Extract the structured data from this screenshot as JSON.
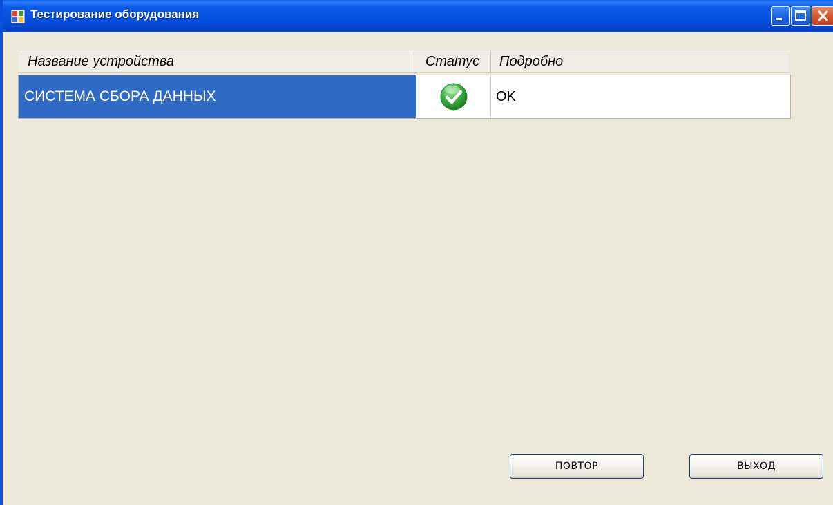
{
  "window": {
    "title": "Тестирование оборудования",
    "icon": "application-icon",
    "controls": [
      "minimize-icon",
      "maximize-icon",
      "close-icon"
    ]
  },
  "grid": {
    "columns": [
      "Название устройства",
      "Статус",
      "Подробно"
    ],
    "rows": [
      {
        "name": "СИСТЕМА СБОРА ДАННЫХ",
        "status_icon": "check-icon",
        "status_color": "#3CB043",
        "detail": "OK",
        "selected": true
      }
    ],
    "selection_color": "#316AC5"
  },
  "buttons": {
    "retry_label": "ПОВТОР",
    "exit_label": "ВЫХОД"
  },
  "colors": {
    "titlebar": "#0650E0",
    "window_bg": "#ECE9D8"
  }
}
